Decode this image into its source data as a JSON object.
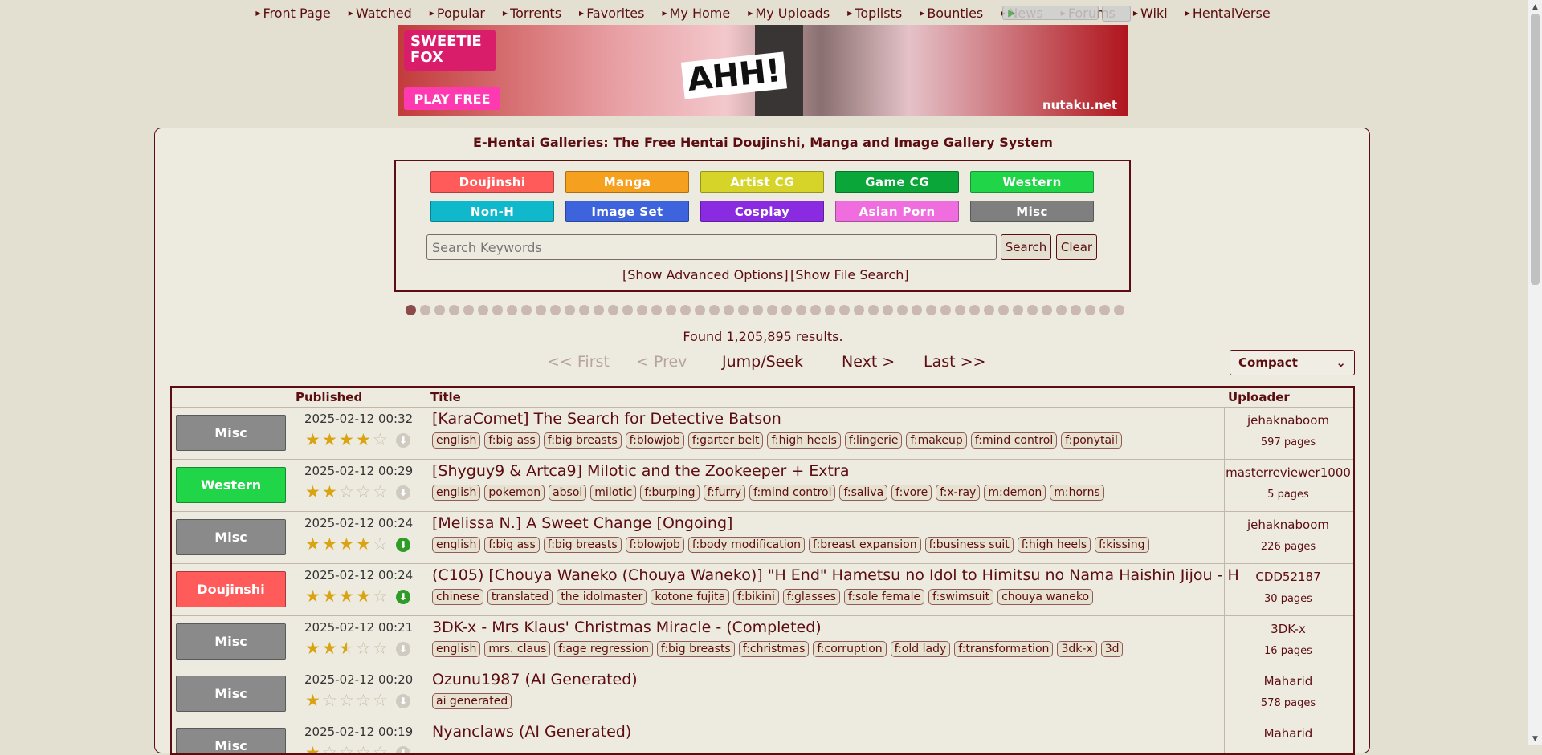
{
  "nav": [
    {
      "label": "Front Page"
    },
    {
      "label": "Watched"
    },
    {
      "label": "Popular"
    },
    {
      "label": "Torrents"
    },
    {
      "label": "Favorites"
    },
    {
      "label": "My Home"
    },
    {
      "label": "My Uploads"
    },
    {
      "label": "Toplists"
    },
    {
      "label": "Bounties"
    },
    {
      "label": "News"
    },
    {
      "label": "Forums"
    },
    {
      "label": "Wiki"
    },
    {
      "label": "HentaiVerse"
    }
  ],
  "banner": {
    "logo": "SWEETIE FOX",
    "cta": "PLAY FREE",
    "shout": "AHH!",
    "brand": "nutaku.net"
  },
  "site_title": "E-Hentai Galleries: The Free Hentai Doujinshi, Manga and Image Gallery System",
  "categories": [
    {
      "label": "Doujinshi",
      "color": "#ff5b5b"
    },
    {
      "label": "Manga",
      "color": "#f5a11f"
    },
    {
      "label": "Artist CG",
      "color": "#d6d429"
    },
    {
      "label": "Game CG",
      "color": "#0aa63a"
    },
    {
      "label": "Western",
      "color": "#20d547"
    },
    {
      "label": "Non-H",
      "color": "#10b8cc"
    },
    {
      "label": "Image Set",
      "color": "#3d63dd"
    },
    {
      "label": "Cosplay",
      "color": "#8a2be2"
    },
    {
      "label": "Asian Porn",
      "color": "#f06de0"
    },
    {
      "label": "Misc",
      "color": "#7f7f7f"
    }
  ],
  "search": {
    "placeholder": "Search Keywords",
    "search_label": "Search",
    "clear_label": "Clear",
    "advanced_label": "[Show Advanced Options]",
    "file_label": "[Show File Search]"
  },
  "dots": {
    "count": 50,
    "active_index": 0
  },
  "found": "Found 1,205,895 results.",
  "pagination": {
    "first": "<< First",
    "prev": "< Prev",
    "jump": "Jump/Seek",
    "next": "Next >",
    "last": "Last >>"
  },
  "display_mode": "Compact",
  "table": {
    "headers": {
      "published": "Published",
      "title": "Title",
      "uploader": "Uploader"
    },
    "rows": [
      {
        "category": "Misc",
        "cat_color": "#8a8a8a",
        "date": "2025-02-12 00:32",
        "rating": 4,
        "torrent": false,
        "title": "[KaraComet] The Search for Detective Batson",
        "tags": [
          "english",
          "f:big ass",
          "f:big breasts",
          "f:blowjob",
          "f:garter belt",
          "f:high heels",
          "f:lingerie",
          "f:makeup",
          "f:mind control",
          "f:ponytail"
        ],
        "uploader": "jehaknaboom",
        "pages": "597 pages"
      },
      {
        "category": "Western",
        "cat_color": "#20d547",
        "date": "2025-02-12 00:29",
        "rating": 2,
        "torrent": false,
        "title": "[Shyguy9 & Artca9] Milotic and the Zookeeper + Extra",
        "tags": [
          "english",
          "pokemon",
          "absol",
          "milotic",
          "f:burping",
          "f:furry",
          "f:mind control",
          "f:saliva",
          "f:vore",
          "f:x-ray",
          "m:demon",
          "m:horns"
        ],
        "uploader": "masterreviewer1000",
        "pages": "5 pages"
      },
      {
        "category": "Misc",
        "cat_color": "#8a8a8a",
        "date": "2025-02-12 00:24",
        "rating": 4,
        "torrent": true,
        "title": "[Melissa N.] A Sweet Change [Ongoing]",
        "tags": [
          "english",
          "f:big ass",
          "f:big breasts",
          "f:blowjob",
          "f:body modification",
          "f:breast expansion",
          "f:business suit",
          "f:high heels",
          "f:kissing"
        ],
        "uploader": "jehaknaboom",
        "pages": "226 pages"
      },
      {
        "category": "Doujinshi",
        "cat_color": "#ff5b5b",
        "date": "2025-02-12 00:24",
        "rating": 4,
        "torrent": true,
        "title": "(C105) [Chouya Waneko (Chouya Waneko)] \"H End\" Hametsu no Idol to Himitsu no Nama Haishin Jijou - H",
        "tags": [
          "chinese",
          "translated",
          "the idolmaster",
          "kotone fujita",
          "f:bikini",
          "f:glasses",
          "f:sole female",
          "f:swimsuit",
          "chouya waneko"
        ],
        "uploader": "CDD52187",
        "pages": "30 pages"
      },
      {
        "category": "Misc",
        "cat_color": "#8a8a8a",
        "date": "2025-02-12 00:21",
        "rating": 2.5,
        "torrent": false,
        "title": "3DK-x - Mrs Klaus' Christmas Miracle - (Completed)",
        "tags": [
          "english",
          "mrs. claus",
          "f:age regression",
          "f:big breasts",
          "f:christmas",
          "f:corruption",
          "f:old lady",
          "f:transformation",
          "3dk-x",
          "3d"
        ],
        "uploader": "3DK-x",
        "pages": "16 pages"
      },
      {
        "category": "Misc",
        "cat_color": "#8a8a8a",
        "date": "2025-02-12 00:20",
        "rating": 1,
        "torrent": false,
        "title": "Ozunu1987 (AI Generated)",
        "tags": [
          "ai generated"
        ],
        "uploader": "Maharid",
        "pages": "578 pages"
      },
      {
        "category": "Misc",
        "cat_color": "#8a8a8a",
        "date": "2025-02-12 00:19",
        "rating": 1,
        "torrent": false,
        "title": "Nyanclaws (AI Generated)",
        "tags": [],
        "uploader": "Maharid",
        "pages": ""
      }
    ]
  }
}
